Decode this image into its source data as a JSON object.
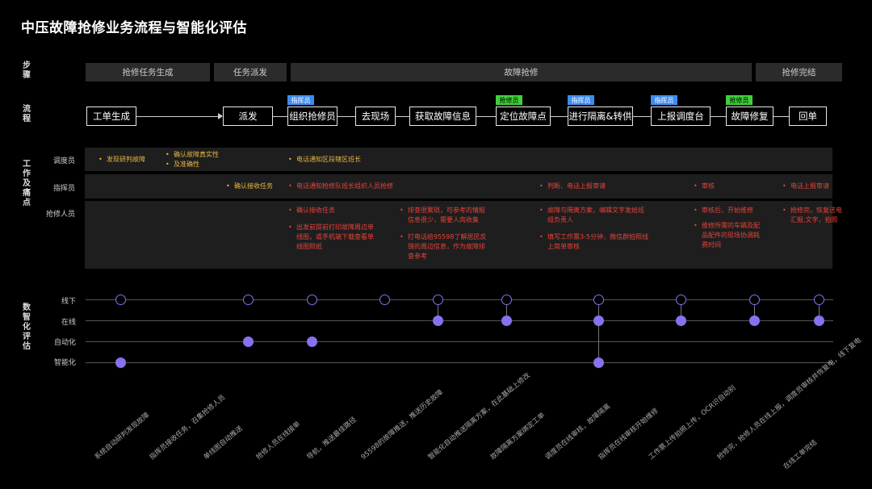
{
  "title": "中压故障抢修业务流程与智能化评估",
  "row_labels": {
    "steps": "步骤",
    "flow": "流程",
    "work": "工作及痛点",
    "digital": "数智化评估"
  },
  "steps": [
    "抢修任务生成",
    "任务派发",
    "故障抢修",
    "抢修完结"
  ],
  "flow": [
    "工单生成",
    "派发",
    "组织抢修员",
    "去现场",
    "获取故障信息",
    "定位故障点",
    "进行隔离&转供",
    "上报调度台",
    "故障修复",
    "回单"
  ],
  "tags": {
    "blue": "指挥员",
    "green": "抢修员"
  },
  "roles": [
    "调度员",
    "指挥员",
    "抢修人员"
  ],
  "notes": {
    "d1": "发现研判故障",
    "d2": "确认故障真实性",
    "d3": "及准确性",
    "d4": "电话通知区段辖区班长",
    "c1": "确认接收任务",
    "c2": "电话通知抢修队班长组织人员抢修",
    "c3": "判断、电话上报审请",
    "c4": "审核",
    "c5": "电话上报审请",
    "r1": "确认接收任务",
    "r2a": "出发前提前打印故障周边单",
    "r2b": "线图，或手机端下载查看单",
    "r2c": "线图照纸",
    "r3a": "排查很繁琐，可参考的情报",
    "r3b": "信息很少，需要人肉收集",
    "r4a": "打电话给95598了解居民反",
    "r4b": "馈的周边信息，作为故障排",
    "r4c": "查参考",
    "r5a": "故障与隔离方案，编辑文字发给班",
    "r5b": "组负责人",
    "r6a": "填写工作票3-5分钟，微信群拍照线",
    "r6b": "上简单审核",
    "r7": "审核后，开始维修",
    "r8a": "维修所需的车辆及配",
    "r8b": "品配件的现场协调耗",
    "r8c": "费时间",
    "r9a": "抢修完，恢复送电",
    "r9b": "汇报,文字，拍照"
  },
  "levels": [
    "线下",
    "在线",
    "自动化",
    "智能化"
  ],
  "bottom_labels": [
    "系统自动研判发现故障",
    "指挥员接收任务，召集抢修人员",
    "单线图自动推送",
    "抢修人员在线接单",
    "导航，推送最佳路径",
    "95598的故障推送，推送历史故障",
    "智能化自动推送隔离方案，在此基础上修改",
    "故障隔离方案绑定工单",
    "调度员在线审核，故障隔离",
    "指挥员在线审核开始维修",
    "工作票上传拍照上传，OCR识自动别",
    "抢修完，抢修人员在线上报，调度员审核并恢复电，线下复电",
    "在线工单完结"
  ],
  "colors": {
    "accent": "#8a70ef",
    "blue_tag": "#3d8bef",
    "green_tag": "#3fcf3a",
    "yellow": "#e8b640",
    "red": "#e8423a"
  }
}
